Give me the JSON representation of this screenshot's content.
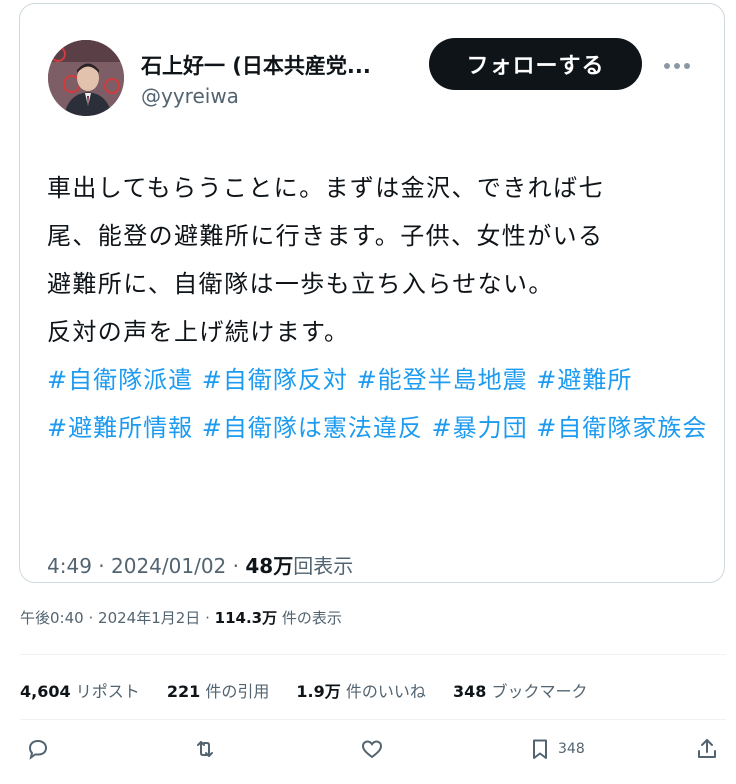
{
  "tweet": {
    "author_name": "石上好一 (日本共産党...",
    "author_handle": "@yyreiwa",
    "follow_label": "フォローする",
    "lines": [
      "車出してもらうことに。まずは金沢、できれば七",
      "尾、能登の避難所に行きます。子供、女性がいる",
      "避難所に、自衛隊は一歩も立ち入らせない。",
      "反対の声を上げ続けます。"
    ],
    "hashtags": [
      "#自衛隊派遣",
      "#自衛隊反対",
      "#能登半島地震",
      "#避難所",
      "#避難所情報",
      "#自衛隊は憲法違反",
      "#暴力団",
      "#自衛隊家族会"
    ],
    "time": "4:49",
    "date": "2024/01/02",
    "views_num": "48万",
    "views_label": "回表示"
  },
  "outer": {
    "time": "午後0:40",
    "date": "2024年1月2日",
    "views_num": "114.3万",
    "views_label": "件の表示",
    "separator": "·"
  },
  "stats": {
    "reposts_num": "4,604",
    "reposts_label": "リポスト",
    "quotes_num": "221",
    "quotes_label": "件の引用",
    "likes_num": "1.9万",
    "likes_label": "件のいいね",
    "bookmarks_num": "348",
    "bookmarks_label": "ブックマーク"
  },
  "actions": {
    "bookmark_count": "348"
  },
  "icons": {
    "reply": "reply-icon",
    "repost": "repost-icon",
    "like": "heart-icon",
    "bookmark": "bookmark-icon",
    "share": "share-icon",
    "more": "more-icon"
  },
  "colors": {
    "link": "#1d9bf0",
    "text": "#0f1419",
    "muted": "#536471",
    "button": "#0f1419"
  }
}
